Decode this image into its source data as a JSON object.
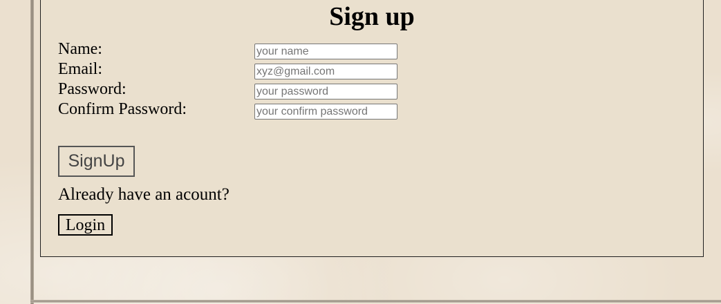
{
  "form": {
    "title": "Sign up",
    "fields": [
      {
        "label": "Name:",
        "placeholder": "your name",
        "value": ""
      },
      {
        "label": "Email:",
        "placeholder": "xyz@gmail.com",
        "value": ""
      },
      {
        "label": "Password:",
        "placeholder": "your password",
        "value": ""
      },
      {
        "label": "Confirm Password:",
        "placeholder": "your confirm password",
        "value": ""
      }
    ],
    "signup_label": "SignUp",
    "already_text": "Already have an acount?",
    "login_label": "Login"
  },
  "colors": {
    "page_background": "#ece1d0",
    "panel_border": "#1e1e1e",
    "signup_text": "#444444",
    "placeholder_text": "#757575"
  }
}
